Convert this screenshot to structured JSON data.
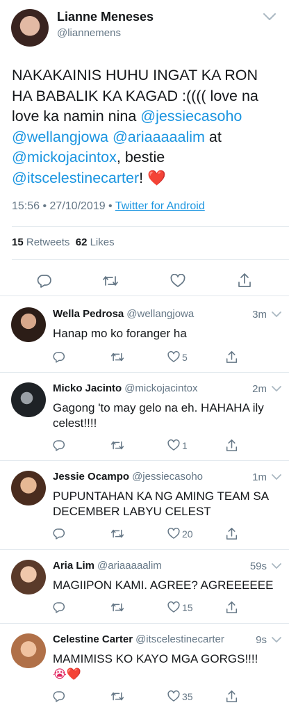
{
  "main": {
    "name": "Lianne Meneses",
    "handle": "@liannemens",
    "text_plain": "NAKAKAINIS HUHU INGAT KA RON HA BABALIK KA KAGAD :(((( love na love ka namin nina ",
    "mention1": "@jessiecasoho",
    "mention2": "@wellangjowa",
    "mention3": "@ariaaaaalim",
    "text_at": " at ",
    "mention4": "@mickojacintox",
    "text_bestie": ", bestie ",
    "mention5": "@itscelestinecarter",
    "text_end": "! ",
    "heart": "❤️",
    "time": "15:56 • 27/10/2019 • ",
    "client": "Twitter for Android",
    "retweets_count": "15",
    "retweets_label": "Retweets",
    "likes_count": "62",
    "likes_label": "Likes"
  },
  "replies": [
    {
      "name": "Wella Pedrosa",
      "handle": "@wellangjowa",
      "time": "3m",
      "text": "Hanap mo ko foranger ha",
      "likes": "5"
    },
    {
      "name": "Micko Jacinto",
      "handle": "@mickojacintox",
      "time": "2m",
      "text": "Gagong 'to may gelo na eh. HAHAHA ily celest!!!!",
      "likes": "1"
    },
    {
      "name": "Jessie Ocampo",
      "handle": "@jessiecasoho",
      "time": "1m",
      "text": "PUPUNTAHAN KA NG AMING TEAM SA DECEMBER LABYU CELEST",
      "likes": "20"
    },
    {
      "name": "Aria Lim",
      "handle": "@ariaaaaalim",
      "time": "59s",
      "text": "MAGIIPON KAMI. AGREE? AGREEEEEE",
      "likes": "15"
    },
    {
      "name": "Celestine Carter",
      "handle": "@itscelestinecarter",
      "time": "9s",
      "text": "MAMIMISS KO KAYO MGA GORGS!!!!",
      "emoji": "😭❤️",
      "likes": "35"
    }
  ],
  "colors": {
    "link": "#1b95e0",
    "muted": "#657786",
    "text": "#14171a",
    "divider": "#e1e8ed"
  },
  "icons": [
    "chevron-down-icon",
    "reply-icon",
    "retweet-icon",
    "like-icon",
    "share-icon"
  ]
}
